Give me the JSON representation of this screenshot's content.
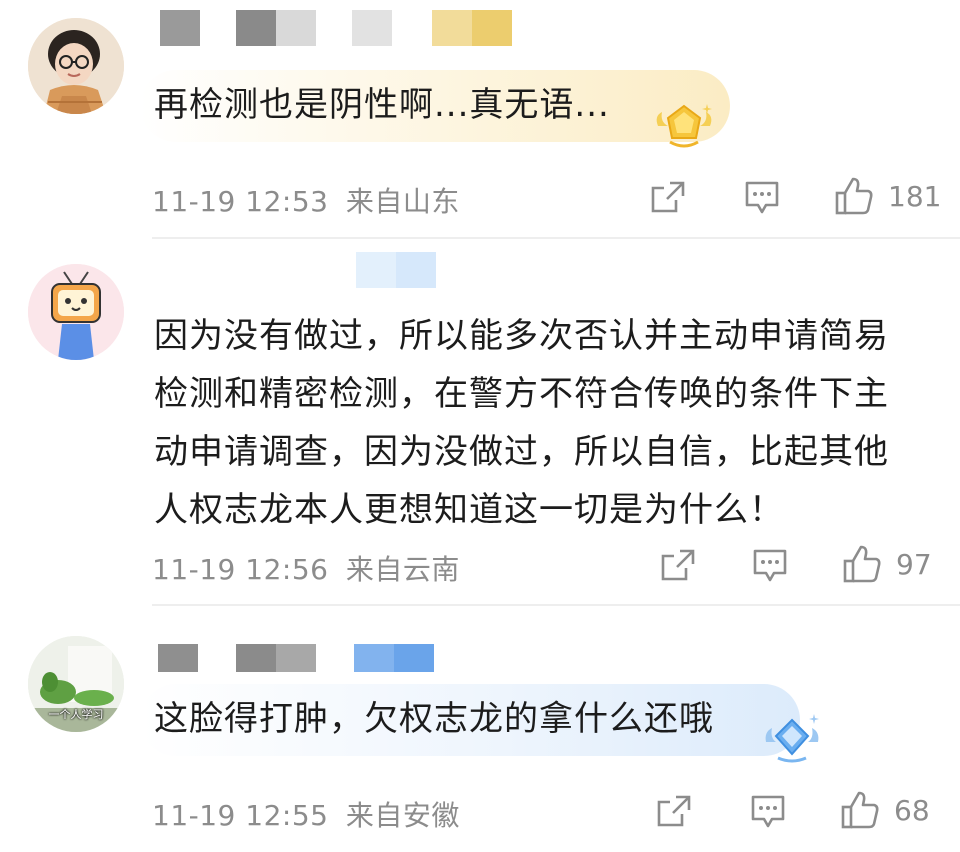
{
  "comments": [
    {
      "text": "再检测也是阴性啊...真无语...",
      "time": "11-19 12:53",
      "location": "来自山东",
      "likes": "181",
      "badge": "gold-crown-badge"
    },
    {
      "text_lines": [
        "因为没有做过，所以能多次否认并主动申请简易",
        "检测和精密检测，在警方不符合传唤的条件下主",
        "动申请调查，因为没做过，所以自信，比起其他",
        "人权志龙本人更想知道这一切是为什么！"
      ],
      "time": "11-19 12:56",
      "location": "来自云南",
      "likes": "97"
    },
    {
      "text": "这脸得打肿，欠权志龙的拿什么还哦",
      "time": "11-19 12:55",
      "location": "来自安徽",
      "likes": "68",
      "avatar_caption": "一个人学习",
      "badge": "blue-diamond-badge"
    }
  ],
  "icons": {
    "share": "share-icon",
    "comment": "comment-icon",
    "like": "thumbs-up-icon"
  },
  "colors": {
    "meta_gray": "#8c8c8c",
    "gold_bubble": "#fdf3d8",
    "blue_bubble": "#e6f1fd"
  }
}
